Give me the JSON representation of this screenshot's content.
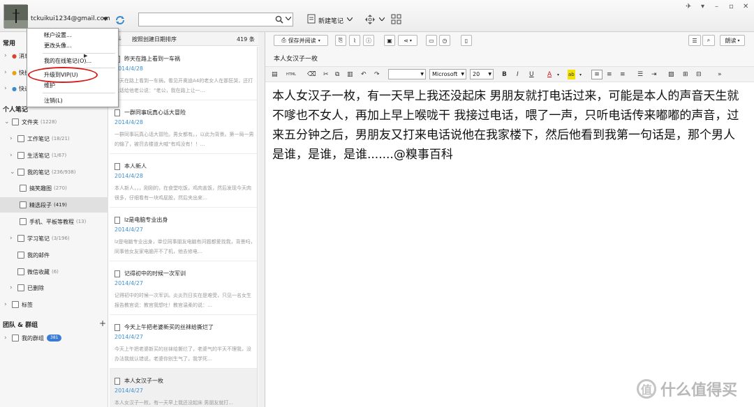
{
  "account": {
    "email": "tckuikui1234@gmail.com"
  },
  "toolbar": {
    "new_note": "新建笔记"
  },
  "menu": {
    "items": [
      "帐户设置...",
      "更改头像...",
      "我的在线笔记(O)...",
      "升级到VIP(U)",
      "维护",
      "注销(L)"
    ],
    "highlighted": "升级到VIP(U)"
  },
  "sidebar": {
    "frequent_header": "常用",
    "frequent_items": [
      "消息",
      "快捷",
      "快速"
    ],
    "personal_header": "个人笔记",
    "folders": [
      {
        "label": "文件夹",
        "count": "(1228)"
      },
      {
        "label": "工作笔记",
        "count": "(18/21)"
      },
      {
        "label": "生活笔记",
        "count": "(1/67)"
      },
      {
        "label": "我的笔记",
        "count": "(236/938)"
      },
      {
        "label": "搞笑趣图",
        "count": "(270)"
      },
      {
        "label": "精选段子",
        "count": "(419)"
      },
      {
        "label": "手机、平板等教程",
        "count": "(13)"
      },
      {
        "label": "学习笔记",
        "count": "(3/196)"
      },
      {
        "label": "我的邮件",
        "count": ""
      },
      {
        "label": "微信收藏",
        "count": "(6)"
      },
      {
        "label": "已删除",
        "count": ""
      },
      {
        "label": "标签",
        "count": ""
      }
    ],
    "team_header": "团队 & 群组",
    "groups_label": "我的群组",
    "groups_badge": "381"
  },
  "notelist": {
    "sort_label": "按照创建日期排序",
    "count": "419 条",
    "notes": [
      {
        "title": "昨天在路上看到一车祸",
        "date": "2014/4/28",
        "snippet": "昨天在路上看到一车祸，看见开奥迪A4的老女人在那狂哭，还打电话给他老公说：“老公，我在路上让一…"
      },
      {
        "title": "一群同事玩真心话大冒险",
        "date": "2014/4/28",
        "snippet": "一群同事玩真心话大冒险。男女都有。，以此为背景。第一局一男的输了，被罚去楼道大喊“有鸡没有！！…"
      },
      {
        "title": "本人新人",
        "date": "2014/4/28",
        "snippet": "本人新人，，，刚刚的，在食堂吃饭，鸡肉盖饭，然后发现今天肉很多，仔细看有一块鸡屁股，然后夹出来…"
      },
      {
        "title": "lz是电脑专业出身",
        "date": "2014/4/27",
        "snippet": "lz是电脑专业出身，单位同事朋友电脑有问题都爱找我，背景吗，同事他女友家电脑开不了机，他去修电…"
      },
      {
        "title": "记得初中的时候一次军训",
        "date": "2014/4/27",
        "snippet": "记得初中的时候一次军训。炎炎烈日实在是难受，只见一名女生报告教官说：教官我想吐！教官温柔的说：…"
      },
      {
        "title": "今天上午把老婆新买的丝袜给撕烂了",
        "date": "2014/4/27",
        "snippet": "今天上午把老婆新买的丝袜给撕烂了，老婆气的半天不理我，没办法我就认错说，老婆你别生气了，我学死…"
      },
      {
        "title": "本人女汉子一枚",
        "date": "2014/4/27",
        "snippet": "本人女汉子一枚，有一天早上我还没起床 男朋友就打…"
      }
    ]
  },
  "editor": {
    "save_button": "保存并阅读",
    "read_button": "朗读",
    "title": "本人女汉子一枚",
    "font_name": "Microsoft",
    "font_size": "20",
    "body": "本人女汉子一枚，有一天早上我还没起床 男朋友就打电话过来，可能是本人的声音天生就不嗲也不女人，再加上早上喉咙干 我接过电话，喂了一声，只听电话传来嘟嘟的声音，过来五分钟之后，男朋友又打来电话说他在我家楼下，然后他看到我第一句话是，那个男人是谁，是谁，是谁.......@糗事百科"
  },
  "watermark": {
    "text": "什么值得买",
    "glyph": "值"
  },
  "colors": {
    "accent": "#3c8fd0",
    "highlight_ring": "#d81a1a",
    "selected_row": "#e0e0e0"
  }
}
